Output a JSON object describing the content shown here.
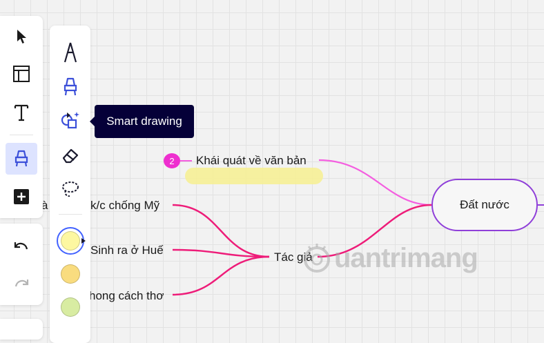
{
  "tooltip": {
    "text": "Smart drawing"
  },
  "toolbar": {
    "tools": [
      "select",
      "templates",
      "text",
      "pen",
      "more"
    ]
  },
  "pen_panel": {
    "tools": [
      "pen",
      "highlighter",
      "smart-drawing",
      "eraser",
      "lasso"
    ],
    "swatches": [
      "#fdf7a1",
      "#f9dc7f",
      "#d8eca2"
    ]
  },
  "mindmap": {
    "root": "Đất nước",
    "branch_top": "Khái quát về văn bản",
    "branch_top_badge": "2",
    "branch_mid": "Tác giả",
    "leaves": [
      "k/c chống Mỹ",
      "Sinh ra ở Huế",
      "hong cách thơ"
    ],
    "left_cut_text": "à"
  },
  "watermark": {
    "text": "uantrimang"
  },
  "colors": {
    "accent": "#4262ff",
    "pink_branch": "#ee1c79",
    "magenta_branch": "#f45ee0",
    "root_border": "#8f3fd9"
  }
}
